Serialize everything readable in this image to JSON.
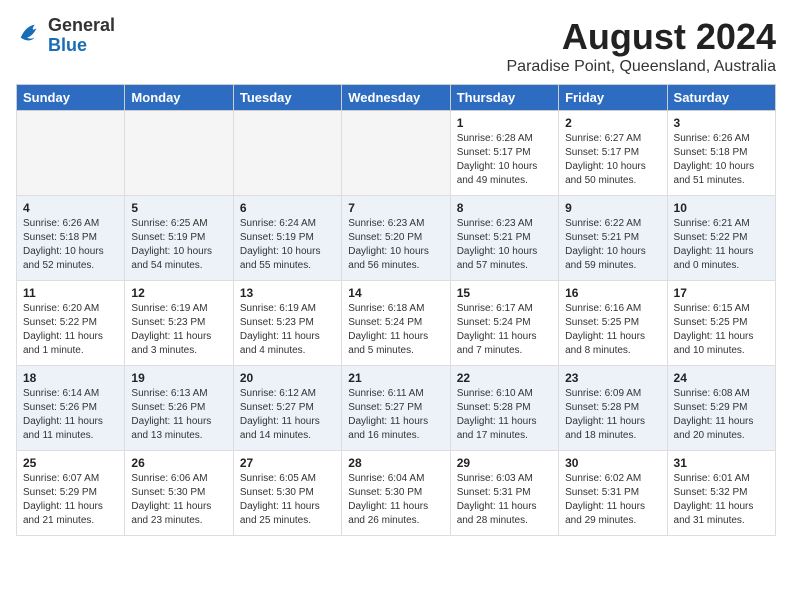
{
  "header": {
    "logo": {
      "general": "General",
      "blue": "Blue"
    },
    "title": "August 2024",
    "subtitle": "Paradise Point, Queensland, Australia"
  },
  "weekdays": [
    "Sunday",
    "Monday",
    "Tuesday",
    "Wednesday",
    "Thursday",
    "Friday",
    "Saturday"
  ],
  "weeks": [
    [
      {
        "day": "",
        "info": ""
      },
      {
        "day": "",
        "info": ""
      },
      {
        "day": "",
        "info": ""
      },
      {
        "day": "",
        "info": ""
      },
      {
        "day": "1",
        "info": "Sunrise: 6:28 AM\nSunset: 5:17 PM\nDaylight: 10 hours\nand 49 minutes."
      },
      {
        "day": "2",
        "info": "Sunrise: 6:27 AM\nSunset: 5:17 PM\nDaylight: 10 hours\nand 50 minutes."
      },
      {
        "day": "3",
        "info": "Sunrise: 6:26 AM\nSunset: 5:18 PM\nDaylight: 10 hours\nand 51 minutes."
      }
    ],
    [
      {
        "day": "4",
        "info": "Sunrise: 6:26 AM\nSunset: 5:18 PM\nDaylight: 10 hours\nand 52 minutes."
      },
      {
        "day": "5",
        "info": "Sunrise: 6:25 AM\nSunset: 5:19 PM\nDaylight: 10 hours\nand 54 minutes."
      },
      {
        "day": "6",
        "info": "Sunrise: 6:24 AM\nSunset: 5:19 PM\nDaylight: 10 hours\nand 55 minutes."
      },
      {
        "day": "7",
        "info": "Sunrise: 6:23 AM\nSunset: 5:20 PM\nDaylight: 10 hours\nand 56 minutes."
      },
      {
        "day": "8",
        "info": "Sunrise: 6:23 AM\nSunset: 5:21 PM\nDaylight: 10 hours\nand 57 minutes."
      },
      {
        "day": "9",
        "info": "Sunrise: 6:22 AM\nSunset: 5:21 PM\nDaylight: 10 hours\nand 59 minutes."
      },
      {
        "day": "10",
        "info": "Sunrise: 6:21 AM\nSunset: 5:22 PM\nDaylight: 11 hours\nand 0 minutes."
      }
    ],
    [
      {
        "day": "11",
        "info": "Sunrise: 6:20 AM\nSunset: 5:22 PM\nDaylight: 11 hours\nand 1 minute."
      },
      {
        "day": "12",
        "info": "Sunrise: 6:19 AM\nSunset: 5:23 PM\nDaylight: 11 hours\nand 3 minutes."
      },
      {
        "day": "13",
        "info": "Sunrise: 6:19 AM\nSunset: 5:23 PM\nDaylight: 11 hours\nand 4 minutes."
      },
      {
        "day": "14",
        "info": "Sunrise: 6:18 AM\nSunset: 5:24 PM\nDaylight: 11 hours\nand 5 minutes."
      },
      {
        "day": "15",
        "info": "Sunrise: 6:17 AM\nSunset: 5:24 PM\nDaylight: 11 hours\nand 7 minutes."
      },
      {
        "day": "16",
        "info": "Sunrise: 6:16 AM\nSunset: 5:25 PM\nDaylight: 11 hours\nand 8 minutes."
      },
      {
        "day": "17",
        "info": "Sunrise: 6:15 AM\nSunset: 5:25 PM\nDaylight: 11 hours\nand 10 minutes."
      }
    ],
    [
      {
        "day": "18",
        "info": "Sunrise: 6:14 AM\nSunset: 5:26 PM\nDaylight: 11 hours\nand 11 minutes."
      },
      {
        "day": "19",
        "info": "Sunrise: 6:13 AM\nSunset: 5:26 PM\nDaylight: 11 hours\nand 13 minutes."
      },
      {
        "day": "20",
        "info": "Sunrise: 6:12 AM\nSunset: 5:27 PM\nDaylight: 11 hours\nand 14 minutes."
      },
      {
        "day": "21",
        "info": "Sunrise: 6:11 AM\nSunset: 5:27 PM\nDaylight: 11 hours\nand 16 minutes."
      },
      {
        "day": "22",
        "info": "Sunrise: 6:10 AM\nSunset: 5:28 PM\nDaylight: 11 hours\nand 17 minutes."
      },
      {
        "day": "23",
        "info": "Sunrise: 6:09 AM\nSunset: 5:28 PM\nDaylight: 11 hours\nand 18 minutes."
      },
      {
        "day": "24",
        "info": "Sunrise: 6:08 AM\nSunset: 5:29 PM\nDaylight: 11 hours\nand 20 minutes."
      }
    ],
    [
      {
        "day": "25",
        "info": "Sunrise: 6:07 AM\nSunset: 5:29 PM\nDaylight: 11 hours\nand 21 minutes."
      },
      {
        "day": "26",
        "info": "Sunrise: 6:06 AM\nSunset: 5:30 PM\nDaylight: 11 hours\nand 23 minutes."
      },
      {
        "day": "27",
        "info": "Sunrise: 6:05 AM\nSunset: 5:30 PM\nDaylight: 11 hours\nand 25 minutes."
      },
      {
        "day": "28",
        "info": "Sunrise: 6:04 AM\nSunset: 5:30 PM\nDaylight: 11 hours\nand 26 minutes."
      },
      {
        "day": "29",
        "info": "Sunrise: 6:03 AM\nSunset: 5:31 PM\nDaylight: 11 hours\nand 28 minutes."
      },
      {
        "day": "30",
        "info": "Sunrise: 6:02 AM\nSunset: 5:31 PM\nDaylight: 11 hours\nand 29 minutes."
      },
      {
        "day": "31",
        "info": "Sunrise: 6:01 AM\nSunset: 5:32 PM\nDaylight: 11 hours\nand 31 minutes."
      }
    ]
  ]
}
